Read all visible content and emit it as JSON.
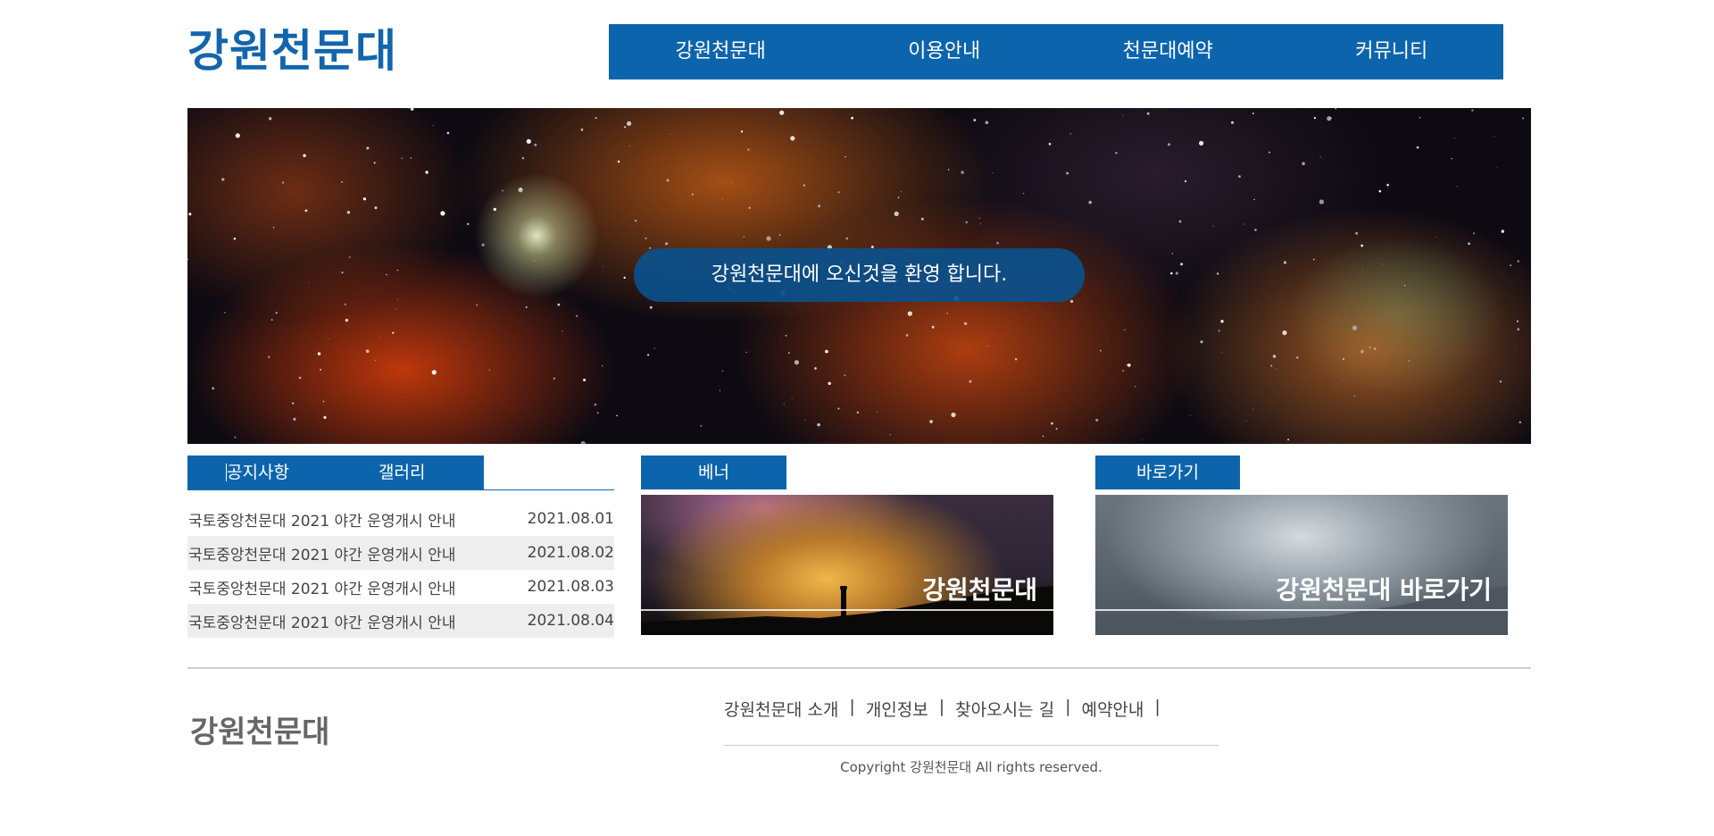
{
  "header": {
    "logo": "강원천문대",
    "nav": [
      "강원천문대",
      "이용안내",
      "천문대예약",
      "커뮤니티"
    ]
  },
  "hero": {
    "welcome_text": "강원천문대에 오신것을 환영 합니다."
  },
  "notice": {
    "tabs": [
      "공지사항",
      "갤러리"
    ],
    "items": [
      {
        "title": "국토중앙천문대 2021 야간 운영개시 안내",
        "date": "2021.08.01"
      },
      {
        "title": "국토중앙천문대 2021 야간 운영개시 안내",
        "date": "2021.08.02"
      },
      {
        "title": "국토중앙천문대 2021 야간 운영개시 안내",
        "date": "2021.08.03"
      },
      {
        "title": "국토중앙천문대 2021 야간 운영개시 안내",
        "date": "2021.08.04"
      }
    ]
  },
  "banner": {
    "heading": "베너",
    "image_text": "강원천문대"
  },
  "shortcut": {
    "heading": "바로가기",
    "image_text": "강원천문대 바로가기"
  },
  "footer": {
    "logo": "강원천문대",
    "links": [
      "강원천문대 소개",
      "개인정보",
      "찾아오시는 길",
      "예약안내"
    ],
    "separator": "|",
    "copyright": "Copyright 강원천문대 All rights reserved."
  },
  "colors": {
    "accent": "#0c65ac",
    "logo": "#1265ad"
  }
}
